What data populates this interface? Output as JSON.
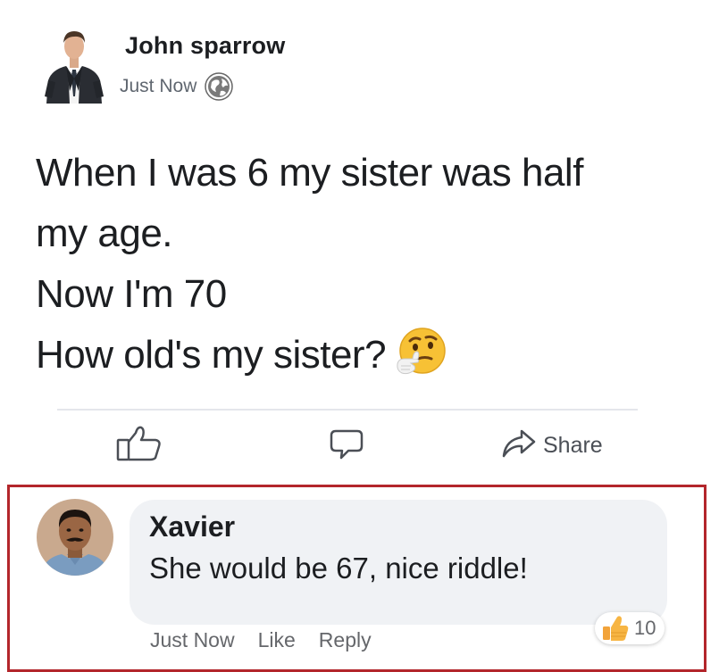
{
  "post": {
    "author": "John sparrow",
    "time": "Just Now",
    "lines": [
      "When I was 6 my sister was half",
      "my age.",
      "Now I'm 70",
      "How old's my sister?"
    ],
    "emoji": "thinking-face-icon",
    "privacy_icon": "globe-icon"
  },
  "actions": {
    "like_icon": "thumbs-up-outline-icon",
    "comment_icon": "speech-bubble-icon",
    "share_icon": "share-arrow-icon",
    "share_label": "Share"
  },
  "comment": {
    "name": "Xavier",
    "text": "She would be 67, nice riddle!",
    "time": "Just Now",
    "like_label": "Like",
    "reply_label": "Reply",
    "reaction_icon": "thumbs-up-reaction-icon",
    "reaction_count": "10",
    "highlight_color": "#b3262b"
  },
  "colors": {
    "text": "#1c1e21",
    "secondary_text": "#606770",
    "bubble": "#f0f2f5"
  }
}
